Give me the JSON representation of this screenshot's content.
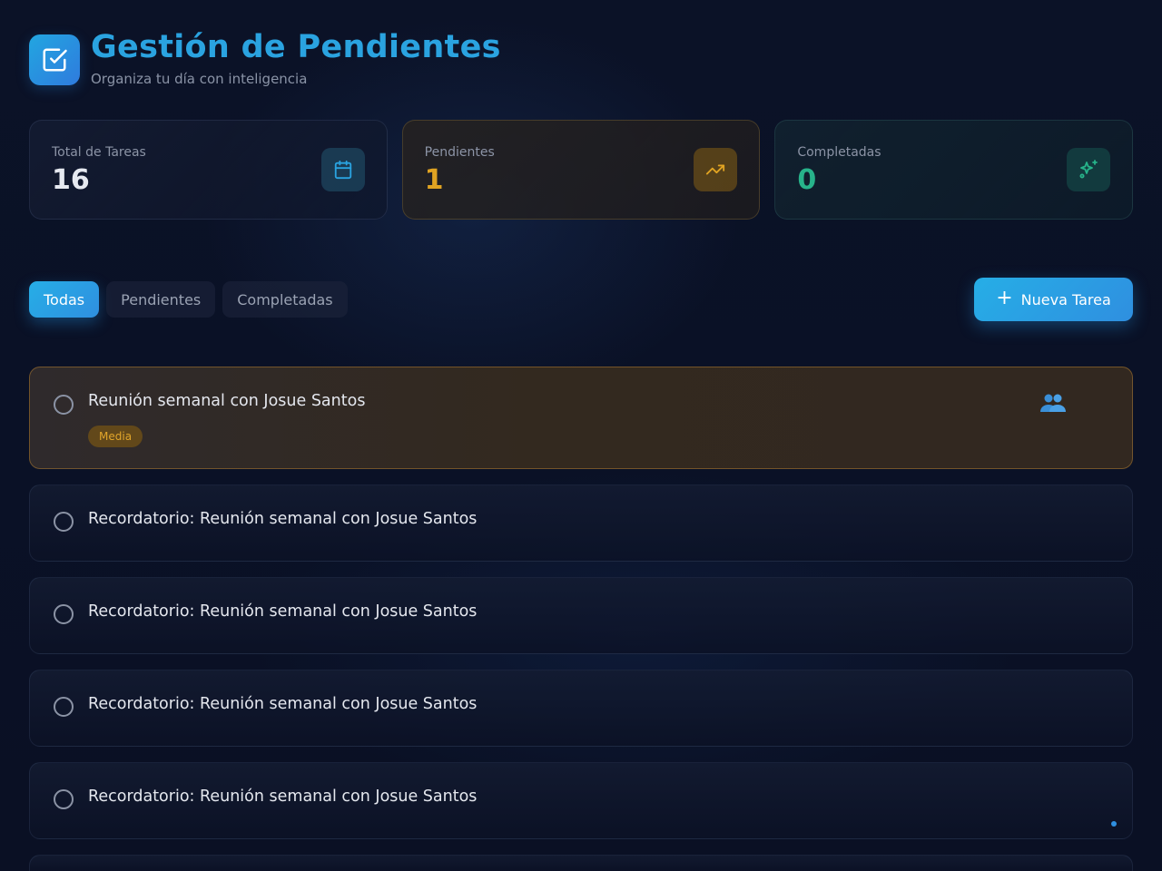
{
  "header": {
    "title": "Gestión de Pendientes",
    "subtitle": "Organiza tu día con inteligencia",
    "logo_icon": "checkbox-edit-icon"
  },
  "stats": [
    {
      "label": "Total de Tareas",
      "value": "16",
      "icon": "calendar-icon",
      "color": "#e6e9f0"
    },
    {
      "label": "Pendientes",
      "value": "1",
      "icon": "trending-up-icon",
      "color": "#e0a322"
    },
    {
      "label": "Completadas",
      "value": "0",
      "icon": "sparkles-icon",
      "color": "#27b38a"
    }
  ],
  "filters": [
    {
      "label": "Todas",
      "active": true
    },
    {
      "label": "Pendientes",
      "active": false
    },
    {
      "label": "Completadas",
      "active": false
    }
  ],
  "new_task_label": "Nueva Tarea",
  "tasks": [
    {
      "title": "Reunión semanal con Josue Santos",
      "priority": "Media",
      "icon": "people-icon",
      "highlighted": true
    },
    {
      "title": "Recordatorio: Reunión semanal con Josue Santos"
    },
    {
      "title": "Recordatorio: Reunión semanal con Josue Santos"
    },
    {
      "title": "Recordatorio: Reunión semanal con Josue Santos"
    },
    {
      "title": "Recordatorio: Reunión semanal con Josue Santos"
    }
  ],
  "colors": {
    "accent": "#2aa3e0",
    "pending": "#e0a322",
    "completed": "#27b38a",
    "background": "#0a1023"
  }
}
